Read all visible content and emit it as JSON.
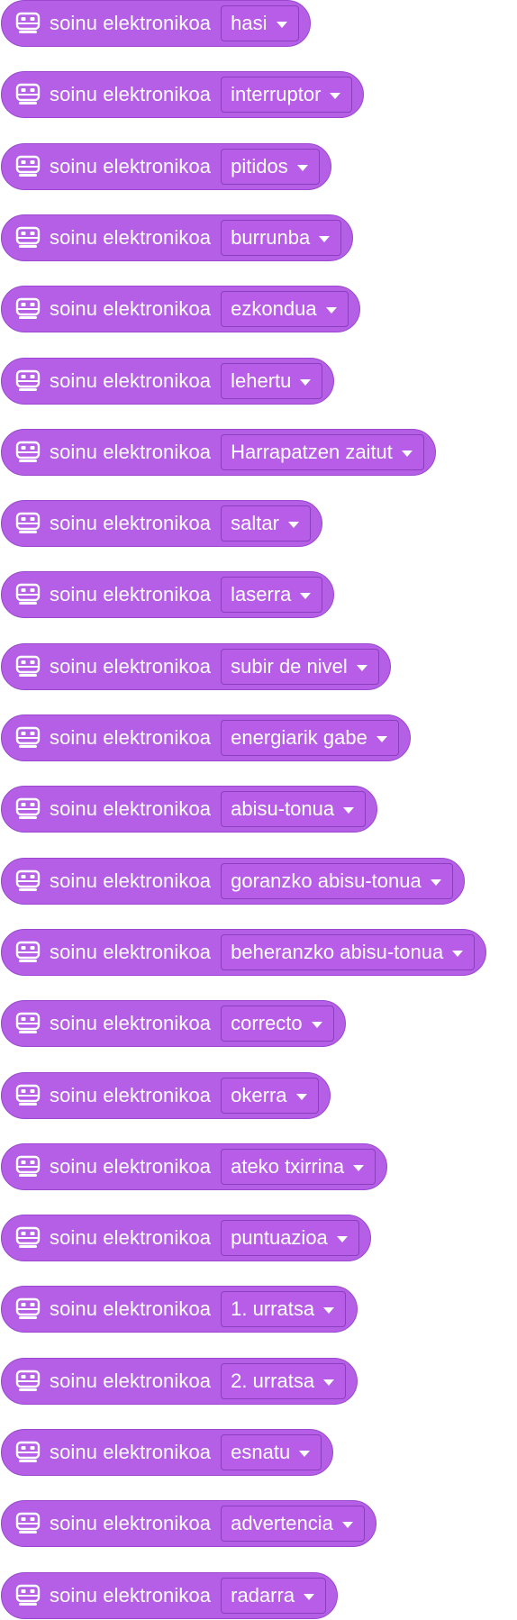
{
  "blocks": [
    {
      "label": "soinu elektronikoa",
      "value": "hasi",
      "icon": "robot-face-icon"
    },
    {
      "label": "soinu elektronikoa",
      "value": "interruptor",
      "icon": "robot-face-icon"
    },
    {
      "label": "soinu elektronikoa",
      "value": "pitidos",
      "icon": "robot-face-icon"
    },
    {
      "label": "soinu elektronikoa",
      "value": "burrunba",
      "icon": "robot-face-icon"
    },
    {
      "label": "soinu elektronikoa",
      "value": "ezkondua",
      "icon": "robot-face-icon"
    },
    {
      "label": "soinu elektronikoa",
      "value": "lehertu",
      "icon": "robot-face-icon"
    },
    {
      "label": "soinu elektronikoa",
      "value": "Harrapatzen zaitut",
      "icon": "robot-face-icon"
    },
    {
      "label": "soinu elektronikoa",
      "value": "saltar",
      "icon": "robot-face-icon"
    },
    {
      "label": "soinu elektronikoa",
      "value": "laserra",
      "icon": "robot-face-icon"
    },
    {
      "label": "soinu elektronikoa",
      "value": "subir de nivel",
      "icon": "robot-face-icon"
    },
    {
      "label": "soinu elektronikoa",
      "value": "energiarik gabe",
      "icon": "robot-face-icon"
    },
    {
      "label": "soinu elektronikoa",
      "value": "abisu-tonua",
      "icon": "robot-face-icon"
    },
    {
      "label": "soinu elektronikoa",
      "value": "goranzko abisu-tonua",
      "icon": "robot-face-icon"
    },
    {
      "label": "soinu elektronikoa",
      "value": "beheranzko abisu-tonua",
      "icon": "robot-face-icon"
    },
    {
      "label": "soinu elektronikoa",
      "value": "correcto",
      "icon": "robot-face-icon"
    },
    {
      "label": "soinu elektronikoa",
      "value": "okerra",
      "icon": "robot-face-icon"
    },
    {
      "label": "soinu elektronikoa",
      "value": "ateko txirrina",
      "icon": "robot-face-icon"
    },
    {
      "label": "soinu elektronikoa",
      "value": "puntuazioa",
      "icon": "robot-face-icon"
    },
    {
      "label": "soinu elektronikoa",
      "value": "1. urratsa",
      "icon": "robot-face-icon"
    },
    {
      "label": "soinu elektronikoa",
      "value": "2. urratsa",
      "icon": "robot-face-icon"
    },
    {
      "label": "soinu elektronikoa",
      "value": "esnatu",
      "icon": "robot-face-icon"
    },
    {
      "label": "soinu elektronikoa",
      "value": "advertencia",
      "icon": "robot-face-icon"
    },
    {
      "label": "soinu elektronikoa",
      "value": "radarra",
      "icon": "robot-face-icon"
    }
  ],
  "colors": {
    "block_fill": "#b45fe6",
    "block_border": "#9b47cf",
    "dropdown_border": "#8b3fbf",
    "text": "#ffffff"
  }
}
